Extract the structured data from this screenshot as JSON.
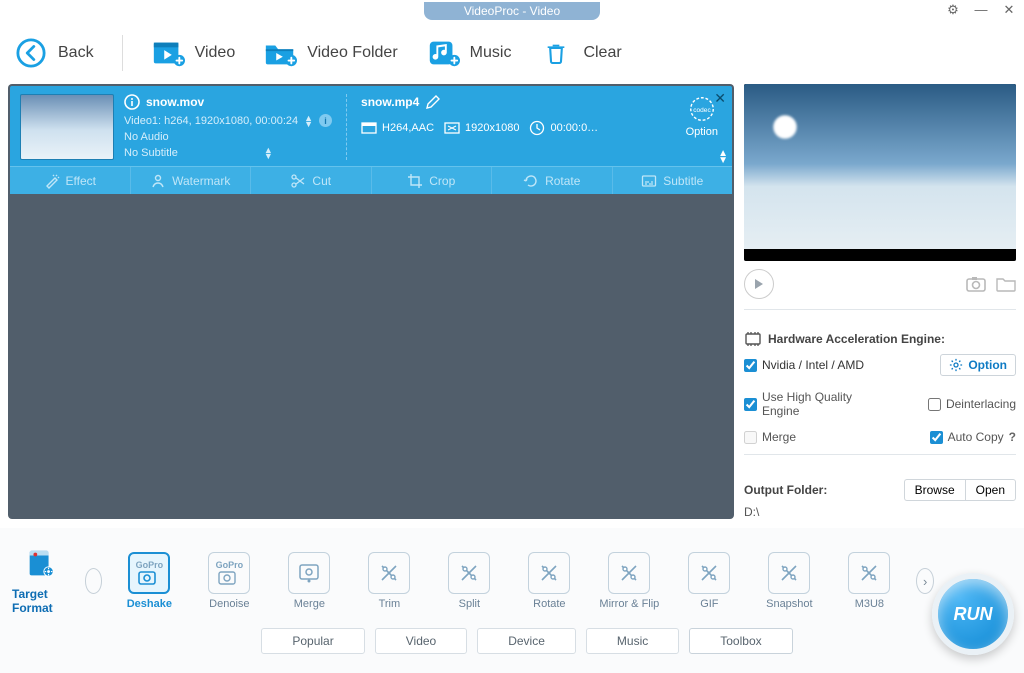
{
  "app_title": "VideoProc - Video",
  "toolbar": {
    "back": "Back",
    "video": "Video",
    "video_folder": "Video Folder",
    "music": "Music",
    "clear": "Clear"
  },
  "item": {
    "src_name": "snow.mov",
    "track_line": "Video1: h264, 1920x1080, 00:00:24",
    "audio_line": "No Audio",
    "subtitle_line": "No Subtitle",
    "dst_name": "snow.mp4",
    "dst_codec": "H264,AAC",
    "dst_res": "1920x1080",
    "dst_dur": "00:00:0…",
    "option_label": "Option",
    "tools": {
      "effect": "Effect",
      "watermark": "Watermark",
      "cut": "Cut",
      "crop": "Crop",
      "rotate": "Rotate",
      "subtitle": "Subtitle"
    }
  },
  "hw": {
    "title": "Hardware Acceleration Engine:",
    "vendor": "Nvidia / Intel / AMD",
    "option_btn": "Option",
    "hq": "Use High Quality Engine",
    "deint": "Deinterlacing",
    "merge": "Merge",
    "autocopy": "Auto Copy",
    "q": "?"
  },
  "output": {
    "label": "Output Folder:",
    "path": "D:\\",
    "browse": "Browse",
    "open": "Open"
  },
  "formats": {
    "target_format": "Target Format",
    "presets": [
      "Deshake",
      "Denoise",
      "Merge",
      "Trim",
      "Split",
      "Rotate",
      "Mirror & Flip",
      "GIF",
      "Snapshot",
      "M3U8"
    ],
    "active_index": 0,
    "tabs": [
      "Popular",
      "Video",
      "Device",
      "Music",
      "Toolbox"
    ],
    "active_tab_index": 4
  },
  "run_label": "RUN"
}
